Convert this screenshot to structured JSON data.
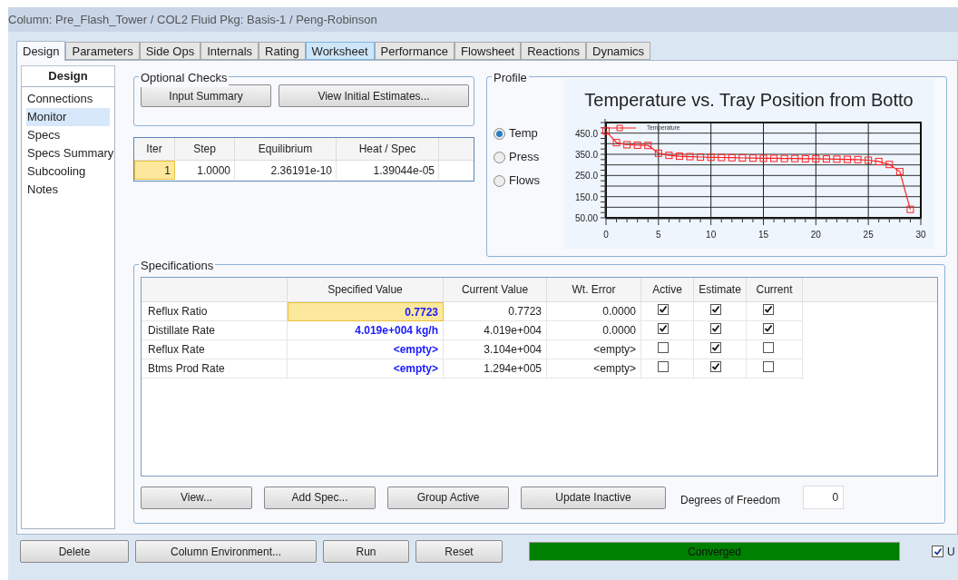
{
  "window": {
    "title": "Column: Pre_Flash_Tower / COL2  Fluid Pkg: Basis-1 / Peng-Robinson"
  },
  "tabs": [
    {
      "label": "Design",
      "selected": true,
      "hovered": false
    },
    {
      "label": "Parameters",
      "selected": false,
      "hovered": false
    },
    {
      "label": "Side Ops",
      "selected": false,
      "hovered": false
    },
    {
      "label": "Internals",
      "selected": false,
      "hovered": false
    },
    {
      "label": "Rating",
      "selected": false,
      "hovered": false
    },
    {
      "label": "Worksheet",
      "selected": false,
      "hovered": true
    },
    {
      "label": "Performance",
      "selected": false,
      "hovered": false
    },
    {
      "label": "Flowsheet",
      "selected": false,
      "hovered": false
    },
    {
      "label": "Reactions",
      "selected": false,
      "hovered": false
    },
    {
      "label": "Dynamics",
      "selected": false,
      "hovered": false
    }
  ],
  "sidebar": {
    "title": "Design",
    "items": [
      {
        "label": "Connections",
        "selected": false
      },
      {
        "label": "Monitor",
        "selected": true
      },
      {
        "label": "Specs",
        "selected": false
      },
      {
        "label": "Specs Summary",
        "selected": false
      },
      {
        "label": "Subcooling",
        "selected": false
      },
      {
        "label": "Notes",
        "selected": false
      }
    ]
  },
  "optional_checks": {
    "title": "Optional Checks",
    "buttons": [
      "Input Summary",
      "View Initial Estimates..."
    ]
  },
  "monitor_table": {
    "columns": [
      "Iter",
      "Step",
      "Equilibrium",
      "Heat / Spec"
    ],
    "rows": [
      {
        "cells": [
          {
            "text": "1",
            "focused": true
          },
          {
            "text": "1.0000",
            "focused": false
          },
          {
            "text": "2.36191e-10",
            "focused": false
          },
          {
            "text": "1.39044e-05",
            "focused": false
          }
        ]
      }
    ]
  },
  "profile": {
    "title": "Profile",
    "options": [
      {
        "label": "Temp",
        "selected": true
      },
      {
        "label": "Press",
        "selected": false
      },
      {
        "label": "Flows",
        "selected": false
      }
    ],
    "chart_data": {
      "type": "line",
      "title": "Temperature vs. Tray Position from Botto",
      "x": [
        0,
        1,
        2,
        3,
        4,
        5,
        6,
        7,
        8,
        9,
        10,
        11,
        12,
        13,
        14,
        15,
        16,
        17,
        18,
        19,
        20,
        21,
        22,
        23,
        24,
        25,
        26,
        27,
        28,
        29
      ],
      "grid": true,
      "series": [
        {
          "name": "Temperature",
          "color": "#ff2020",
          "marker": "square",
          "values": [
            460,
            405,
            395,
            393,
            392,
            355,
            345,
            341,
            339,
            337,
            336,
            335,
            334,
            333,
            332,
            331,
            331,
            330,
            330,
            329,
            329,
            328,
            327,
            326,
            325,
            322,
            316,
            302,
            268,
            90
          ]
        }
      ],
      "xlim": [
        0,
        30
      ],
      "ylim": [
        50,
        500
      ],
      "xticks": [
        0,
        5,
        10,
        15,
        20,
        25,
        30
      ],
      "yticks": [
        {
          "value": 50,
          "label": "50.00"
        },
        {
          "value": 150,
          "label": "150.0"
        },
        {
          "value": 250,
          "label": "250.0"
        },
        {
          "value": 350,
          "label": "350.0"
        },
        {
          "value": 450,
          "label": "450.0"
        }
      ]
    }
  },
  "specifications": {
    "title": "Specifications",
    "columns": [
      "Specified Value",
      "Current Value",
      "Wt. Error",
      "Active",
      "Estimate",
      "Current"
    ],
    "rows": [
      {
        "name": "Reflux Ratio",
        "specified": {
          "text": "0.7723",
          "focused": true
        },
        "current": "0.7723",
        "wt_error": "0.0000",
        "active": true,
        "estimate": true,
        "current_flag": true
      },
      {
        "name": "Distillate Rate",
        "specified": {
          "text": "4.019e+004 kg/h",
          "focused": false
        },
        "current": "4.019e+004",
        "wt_error": "0.0000",
        "active": true,
        "estimate": true,
        "current_flag": true
      },
      {
        "name": "Reflux Rate",
        "specified": {
          "text": "<empty>",
          "focused": false
        },
        "current": "3.104e+004",
        "wt_error": "<empty>",
        "active": false,
        "estimate": true,
        "current_flag": false
      },
      {
        "name": "Btms Prod Rate",
        "specified": {
          "text": "<empty>",
          "focused": false
        },
        "current": "1.294e+005",
        "wt_error": "<empty>",
        "active": false,
        "estimate": true,
        "current_flag": false
      }
    ],
    "buttons": [
      "View...",
      "Add Spec...",
      "Group Active",
      "Update Inactive"
    ],
    "degrees_of_freedom": {
      "label": "Degrees of Freedom",
      "value": "0"
    }
  },
  "bottom_buttons": [
    "Delete",
    "Column Environment...",
    "Run",
    "Reset"
  ],
  "status": {
    "text": "Converged",
    "level": 1
  },
  "update_checkbox": {
    "label": "U",
    "checked": true
  }
}
